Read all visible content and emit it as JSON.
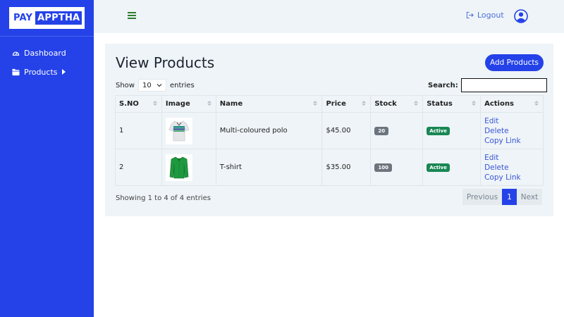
{
  "brand": {
    "part1": "PAY",
    "part2": "APPTHA"
  },
  "sidebar": {
    "items": [
      {
        "label": "Dashboard",
        "icon": "gauge-icon"
      },
      {
        "label": "Products",
        "icon": "folder-icon"
      }
    ]
  },
  "topbar": {
    "logout_label": "Logout"
  },
  "main": {
    "title": "View Products",
    "add_button": "Add Products",
    "show_label": "Show",
    "entries_value": "10",
    "entries_label": "entries",
    "search_label": "Search:",
    "search_value": "",
    "columns": [
      "S.NO",
      "Image",
      "Name",
      "Price",
      "Stock",
      "Status",
      "Actions"
    ],
    "rows": [
      {
        "sno": "1",
        "name": "Multi-coloured polo",
        "price": "$45.00",
        "stock": "20",
        "status": "Active",
        "actions": [
          "Edit",
          "Delete",
          "Copy Link"
        ]
      },
      {
        "sno": "2",
        "name": "T-shirt",
        "price": "$35.00",
        "stock": "100",
        "status": "Active",
        "actions": [
          "Edit",
          "Delete",
          "Copy Link"
        ]
      }
    ],
    "info": "Showing 1 to 4 of 4 entries",
    "pagination": {
      "previous": "Previous",
      "current": "1",
      "next": "Next"
    }
  },
  "colors": {
    "primary": "#2442e8",
    "panel": "#eef4f8",
    "success": "#198754",
    "badge_gray": "#6c757d",
    "link": "#3a55d4"
  }
}
